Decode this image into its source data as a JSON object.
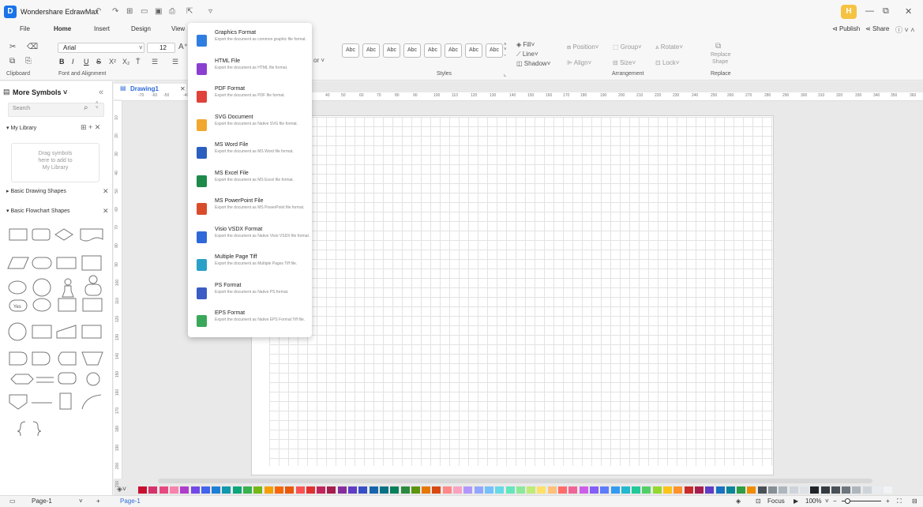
{
  "app": {
    "title": "Wondershare EdrawMax",
    "logo_glyph": "D",
    "user_initial": "H"
  },
  "menu": {
    "tabs": [
      "File",
      "Home",
      "Insert",
      "Design",
      "View"
    ],
    "publish": "Publish",
    "share": "Share"
  },
  "ribbon": {
    "font_name": "Arial",
    "font_size": "12",
    "groups": {
      "clipboard": "Clipboard",
      "font": "Font and Alignment",
      "styles": "Styles",
      "arrangement": "Arrangement",
      "replace": "Replace"
    },
    "style_button": "Abc",
    "fill": "Fill",
    "line": "Line",
    "shadow": "Shadow",
    "position": "Position",
    "group": "Group",
    "rotate": "Rotate",
    "align": "Align",
    "size": "Size",
    "lock": "Lock",
    "replace_shape_1": "Replace",
    "replace_shape_2": "Shape",
    "partial_color_label": "or"
  },
  "left_panel": {
    "title": "More Symbols",
    "search_placeholder": "Search",
    "my_library": "My Library",
    "library_hint_1": "Drag symbols",
    "library_hint_2": "here to add to",
    "library_hint_3": "My Library",
    "basic_drawing": "Basic Drawing Shapes",
    "basic_flowchart": "Basic Flowchart Shapes",
    "yes_shape": "Yes"
  },
  "document": {
    "tab_name": "Drawing1"
  },
  "ruler": {
    "h": [
      "-70",
      "-60",
      "-50",
      "-40",
      "40",
      "50",
      "60",
      "70",
      "80",
      "90",
      "100",
      "110",
      "120",
      "130",
      "140",
      "150",
      "160",
      "170",
      "180",
      "190",
      "200",
      "210",
      "220",
      "230",
      "240",
      "250",
      "260",
      "270",
      "280",
      "290",
      "300",
      "310",
      "320",
      "330",
      "340",
      "350",
      "360"
    ],
    "v": [
      "10",
      "20",
      "30",
      "40",
      "50",
      "60",
      "70",
      "80",
      "90",
      "100",
      "110",
      "120",
      "130",
      "140",
      "150",
      "160",
      "170",
      "180",
      "190",
      "200",
      "210"
    ]
  },
  "export_menu": [
    {
      "title": "Graphics Format",
      "desc": "Export the document as common graphic file format.",
      "color": "#2f7de1",
      "icon": "image-icon"
    },
    {
      "title": "HTML File",
      "desc": "Export the document as HTML file format.",
      "color": "#8a3fd1",
      "icon": "html-icon"
    },
    {
      "title": "PDF Format",
      "desc": "Export the document as PDF file format.",
      "color": "#e0413a",
      "icon": "pdf-icon"
    },
    {
      "title": "SVG Document",
      "desc": "Export the document as Native SVG file format.",
      "color": "#f0a830",
      "icon": "svg-icon"
    },
    {
      "title": "MS Word File",
      "desc": "Export the document as MS Word file format.",
      "color": "#2b5fbf",
      "icon": "word-icon"
    },
    {
      "title": "MS Excel File",
      "desc": "Export the document as MS Excel file format.",
      "color": "#1e8a4a",
      "icon": "excel-icon"
    },
    {
      "title": "MS PowerPoint File",
      "desc": "Export the document as MS PowerPoint file format.",
      "color": "#d94c2b",
      "icon": "powerpoint-icon"
    },
    {
      "title": "Visio VSDX Format",
      "desc": "Export the document as Native Visio VSDX file format.",
      "color": "#2f68d8",
      "icon": "visio-icon"
    },
    {
      "title": "Multiple Page Tiff",
      "desc": "Export the document as Multiple Pages Tiff file.",
      "color": "#2aa0c8",
      "icon": "tiff-icon"
    },
    {
      "title": "PS Format",
      "desc": "Export the document as Native PS format.",
      "color": "#3b5cc4",
      "icon": "ps-icon"
    },
    {
      "title": "EPS Format",
      "desc": "Export the document as Native EPS Format Tiff file.",
      "color": "#3aa85a",
      "icon": "eps-icon"
    }
  ],
  "status": {
    "page_selector": "Page-1",
    "page_tab": "Page-1",
    "focus": "Focus",
    "zoom": "100%"
  },
  "palette_colors": [
    "#c8102e",
    "#d6336c",
    "#e64980",
    "#f783ac",
    "#ae3ec9",
    "#7048e8",
    "#4263eb",
    "#1c7ed6",
    "#1098ad",
    "#0ca678",
    "#37b24d",
    "#74b816",
    "#f59f00",
    "#f76707",
    "#e8590c",
    "#fa5252",
    "#e03131",
    "#c2255c",
    "#a61e4d",
    "#862e9c",
    "#5f3dc4",
    "#364fc7",
    "#1864ab",
    "#0b7285",
    "#087f5b",
    "#2b8a3e",
    "#5c940d",
    "#e67700",
    "#d9480f",
    "#ff8787",
    "#faa2c1",
    "#b197fc",
    "#91a7ff",
    "#74c0fc",
    "#66d9e8",
    "#63e6be",
    "#8ce99a",
    "#c0eb75",
    "#ffe066",
    "#ffc078",
    "#ff6b6b",
    "#f06595",
    "#cc5de8",
    "#845ef7",
    "#5c7cfa",
    "#339af0",
    "#22b8cf",
    "#20c997",
    "#51cf66",
    "#94d82d",
    "#fcc419",
    "#ff922b",
    "#c92a2a",
    "#a61e4d",
    "#5f3dc4",
    "#1971c2",
    "#0c8599",
    "#2f9e44",
    "#f08c00",
    "#495057",
    "#868e96",
    "#adb5bd",
    "#ced4da",
    "#dee2e6",
    "#212529",
    "#343a40",
    "#495057",
    "#6c757d",
    "#adb5bd",
    "#ced4da",
    "#e9ecef",
    "#f1f3f5"
  ]
}
